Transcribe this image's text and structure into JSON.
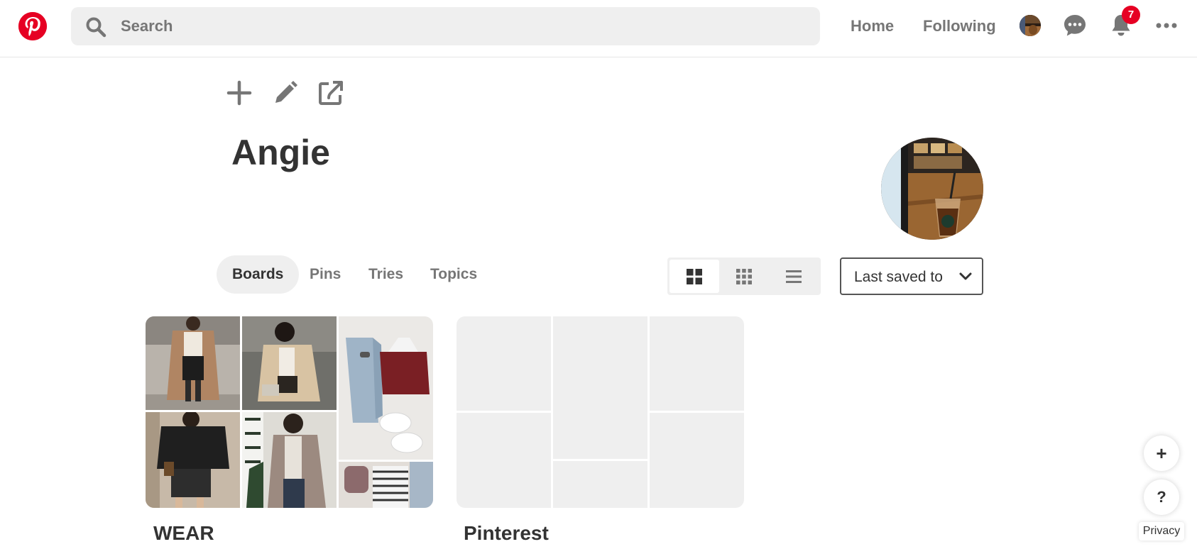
{
  "header": {
    "search_placeholder": "Search",
    "nav": {
      "home": "Home",
      "following": "Following"
    },
    "notification_count": "7",
    "brand_color": "#e60023"
  },
  "profile": {
    "name": "Angie",
    "actions": [
      "add-icon",
      "edit-icon",
      "share-icon"
    ]
  },
  "tabs": [
    {
      "label": "Boards",
      "active": true
    },
    {
      "label": "Pins",
      "active": false
    },
    {
      "label": "Tries",
      "active": false
    },
    {
      "label": "Topics",
      "active": false
    }
  ],
  "view_toggle": {
    "selected": "large-grid",
    "options": [
      "large-grid-icon",
      "small-grid-icon",
      "list-icon"
    ]
  },
  "sort": {
    "label": "Last saved to"
  },
  "boards": [
    {
      "title": "WEAR"
    },
    {
      "title": "Pinterest"
    }
  ],
  "floating": {
    "add": "+",
    "help": "?",
    "privacy": "Privacy"
  }
}
